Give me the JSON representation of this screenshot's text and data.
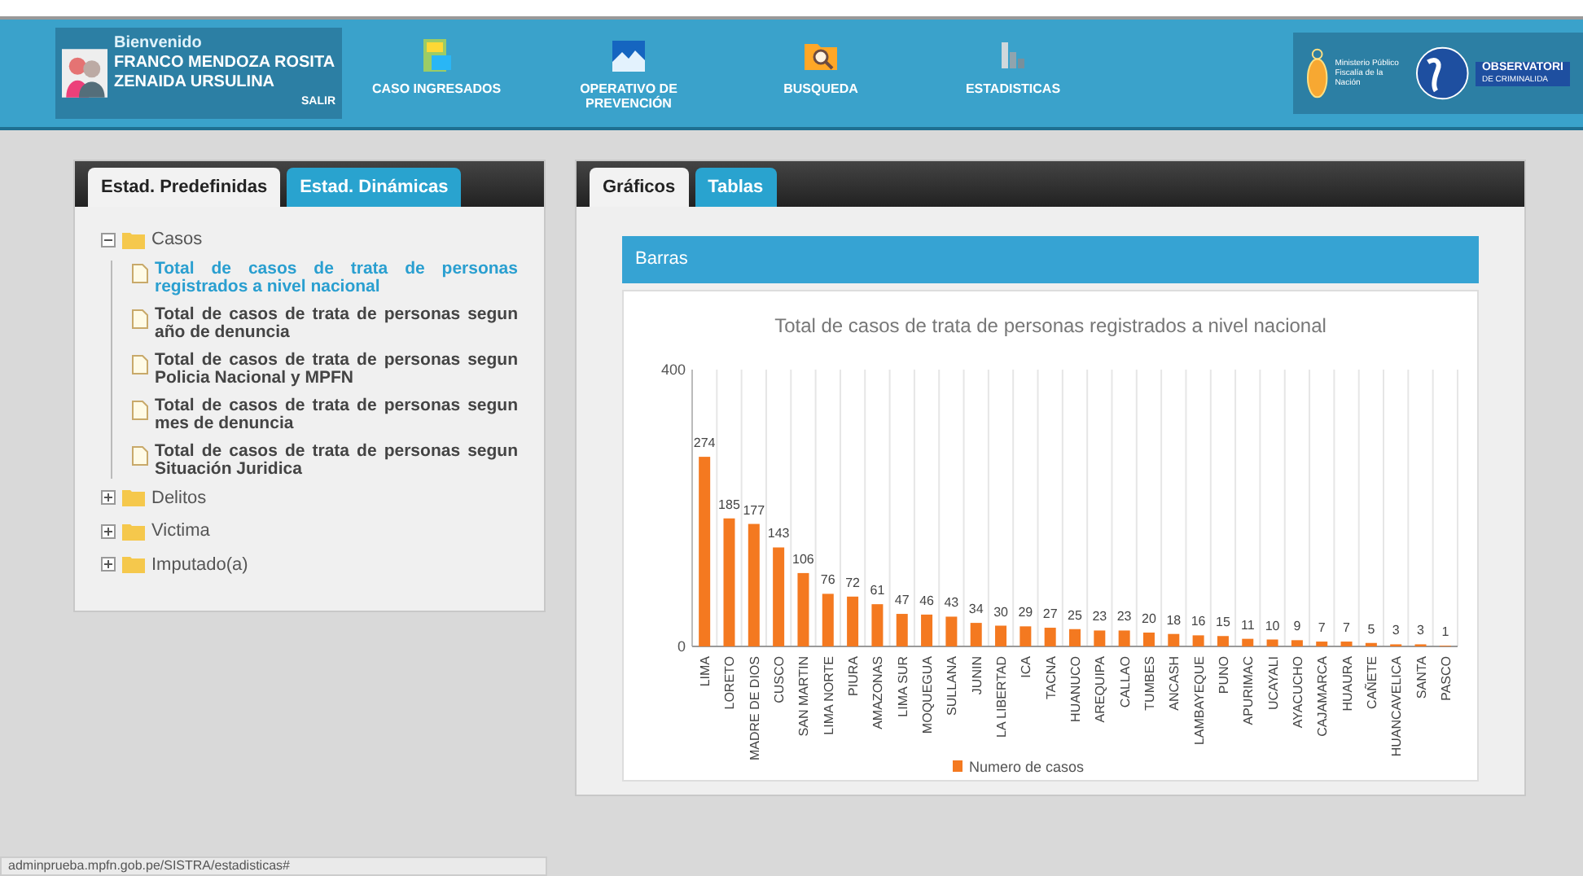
{
  "header": {
    "greeting": "Bienvenido",
    "user_name": "FRANCO MENDOZA ROSITA ZENAIDA URSULINA",
    "logout": "SALIR",
    "nav": [
      {
        "label": "CASO INGRESADOS",
        "kind": "cabinet"
      },
      {
        "label": "OPERATIVO DE PREVENCIÓN",
        "kind": "city"
      },
      {
        "label": "BUSQUEDA",
        "kind": "folder"
      },
      {
        "label": "ESTADISTICAS",
        "kind": "chart"
      }
    ],
    "logos": {
      "ministry": "Ministerio Público Fiscalía de la Nación",
      "observatory": "OBSERVATORI",
      "observatory_sub": "DE CRIMINALIDA"
    }
  },
  "left_panel": {
    "tabs": [
      {
        "label": "Estad. Predefinidas",
        "selected": true
      },
      {
        "label": "Estad. Dinámicas",
        "selected": false
      }
    ],
    "tree": [
      {
        "label": "Casos",
        "expanded": true,
        "children": [
          {
            "label": "Total de casos de trata de personas registrados a nivel nacional",
            "selected": true
          },
          {
            "label": "Total de casos de trata de personas segun año de denuncia",
            "selected": false
          },
          {
            "label": "Total de casos de trata de personas segun Policia Nacional y MPFN",
            "selected": false
          },
          {
            "label": "Total de casos de trata de personas segun mes de denuncia",
            "selected": false
          },
          {
            "label": "Total de casos de trata de personas segun Situación Juridica",
            "selected": false
          }
        ]
      },
      {
        "label": "Delitos",
        "expanded": false
      },
      {
        "label": "Victima",
        "expanded": false
      },
      {
        "label": "Imputado(a)",
        "expanded": false
      }
    ]
  },
  "right_panel": {
    "tabs": [
      {
        "label": "Gráficos",
        "selected": true
      },
      {
        "label": "Tablas",
        "selected": false
      }
    ],
    "section_title": "Barras",
    "chart_data": {
      "type": "bar",
      "title": "Total de casos de trata de personas registrados a nivel nacional",
      "categories": [
        "LIMA",
        "LORETO",
        "MADRE DE DIOS",
        "CUSCO",
        "SAN MARTIN",
        "LIMA NORTE",
        "PIURA",
        "AMAZONAS",
        "LIMA SUR",
        "MOQUEGUA",
        "SULLANA",
        "JUNIN",
        "LA LIBERTAD",
        "ICA",
        "TACNA",
        "HUANUCO",
        "AREQUIPA",
        "CALLAO",
        "TUMBES",
        "ANCASH",
        "LAMBAYEQUE",
        "PUNO",
        "APURIMAC",
        "UCAYALI",
        "AYACUCHO",
        "CAJAMARCA",
        "HUAURA",
        "CAÑETE",
        "HUANCAVELICA",
        "SANTA",
        "PASCO"
      ],
      "series": [
        {
          "name": "Numero de casos",
          "color": "#f47920",
          "values": [
            274,
            185,
            177,
            143,
            106,
            76,
            72,
            61,
            47,
            46,
            43,
            34,
            30,
            29,
            27,
            25,
            23,
            23,
            20,
            18,
            16,
            15,
            11,
            10,
            9,
            7,
            7,
            5,
            3,
            3,
            1
          ]
        }
      ],
      "ylim": [
        0,
        400
      ],
      "yticks": [
        0,
        400
      ],
      "data_labels": true
    }
  },
  "status_bar": "adminprueba.mpfn.gob.pe/SISTRA/estadisticas#"
}
